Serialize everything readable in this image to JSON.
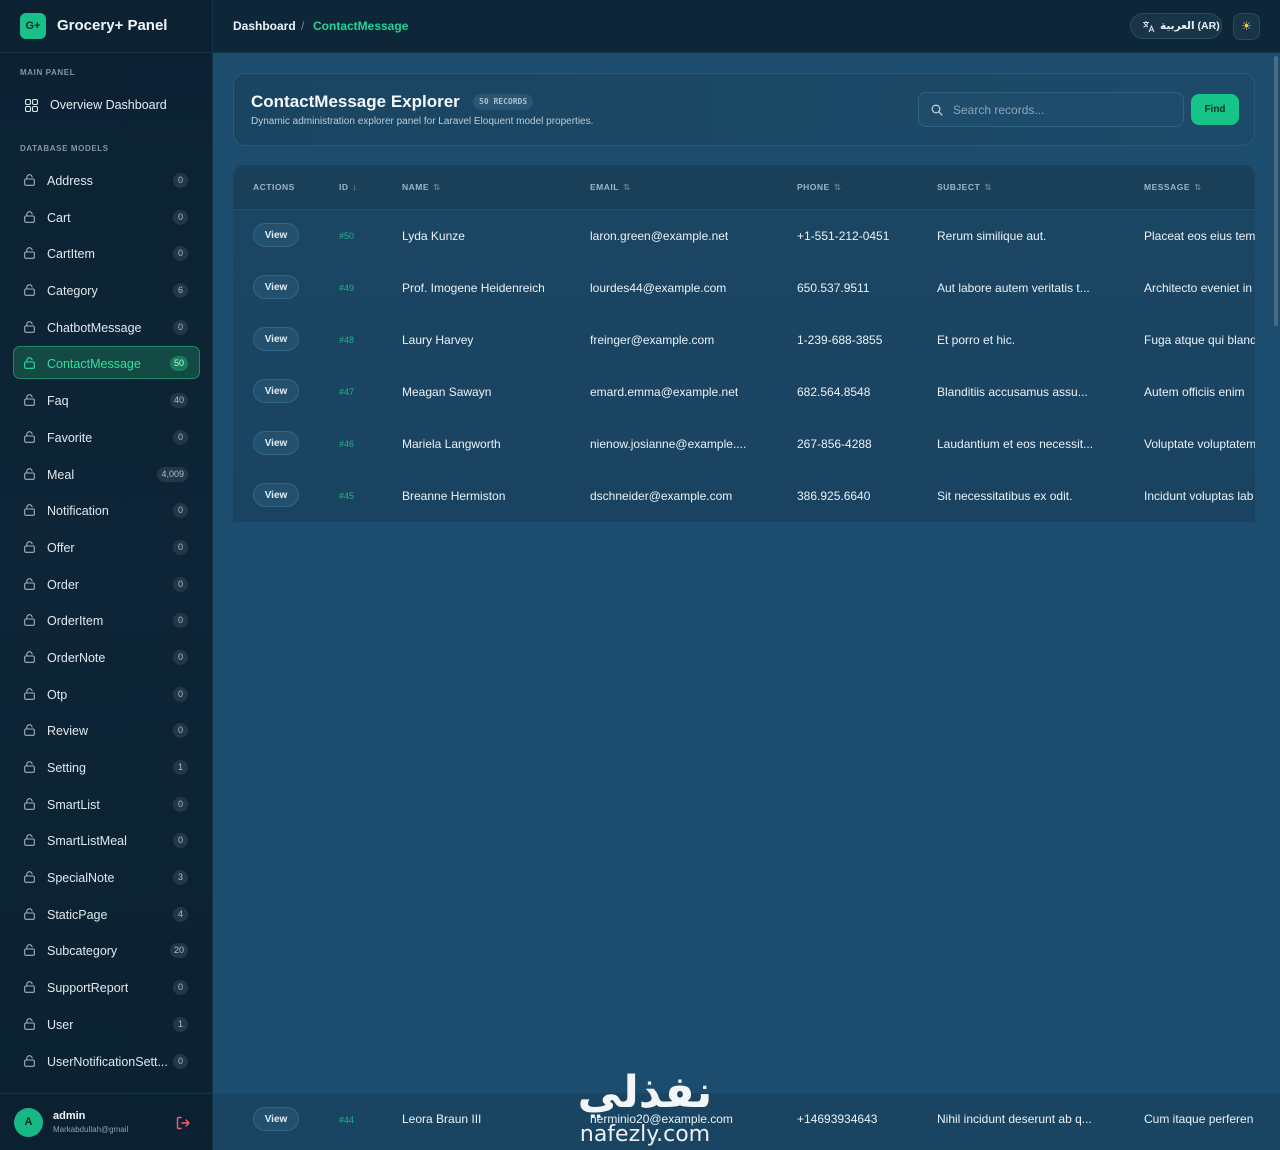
{
  "brand": {
    "logo": "G+",
    "title": "Grocery+ Panel"
  },
  "sidebar": {
    "main_label": "MAIN PANEL",
    "overview_label": "Overview Dashboard",
    "models_label": "DATABASE MODELS",
    "items": [
      {
        "label": "Address",
        "count": "0"
      },
      {
        "label": "Cart",
        "count": "0"
      },
      {
        "label": "CartItem",
        "count": "0"
      },
      {
        "label": "Category",
        "count": "6"
      },
      {
        "label": "ChatbotMessage",
        "count": "0"
      },
      {
        "label": "ContactMessage",
        "count": "50",
        "active": true
      },
      {
        "label": "Faq",
        "count": "40"
      },
      {
        "label": "Favorite",
        "count": "0"
      },
      {
        "label": "Meal",
        "count": "4,009"
      },
      {
        "label": "Notification",
        "count": "0"
      },
      {
        "label": "Offer",
        "count": "0"
      },
      {
        "label": "Order",
        "count": "0"
      },
      {
        "label": "OrderItem",
        "count": "0"
      },
      {
        "label": "OrderNote",
        "count": "0"
      },
      {
        "label": "Otp",
        "count": "0"
      },
      {
        "label": "Review",
        "count": "0"
      },
      {
        "label": "Setting",
        "count": "1"
      },
      {
        "label": "SmartList",
        "count": "0"
      },
      {
        "label": "SmartListMeal",
        "count": "0"
      },
      {
        "label": "SpecialNote",
        "count": "3"
      },
      {
        "label": "StaticPage",
        "count": "4"
      },
      {
        "label": "Subcategory",
        "count": "20"
      },
      {
        "label": "SupportReport",
        "count": "0"
      },
      {
        "label": "User",
        "count": "1"
      },
      {
        "label": "UserNotificationSett...",
        "count": "0"
      }
    ],
    "user": {
      "initial": "A",
      "name": "admin",
      "email": "Markabdullah@gmail"
    }
  },
  "topbar": {
    "crumb_home": "Dashboard",
    "crumb_sep": "/",
    "crumb_current": "ContactMessage",
    "lang_label": "العربية (AR)"
  },
  "header": {
    "title": "ContactMessage Explorer",
    "badge": "50 RECORDS",
    "subtitle": "Dynamic administration explorer panel for Laravel Eloquent model properties.",
    "search_placeholder": "Search records...",
    "find_label": "Find"
  },
  "table": {
    "columns": {
      "actions": "ACTIONS",
      "id": "ID",
      "name": "NAME",
      "email": "EMAIL",
      "phone": "PHONE",
      "subject": "SUBJECT",
      "message": "MESSAGE"
    },
    "view_label": "View",
    "rows": [
      {
        "id": "#50",
        "name": "Lyda Kunze",
        "email": "laron.green@example.net",
        "phone": "+1-551-212-0451",
        "subject": "Rerum similique aut.",
        "message": "Placeat eos eius tem"
      },
      {
        "id": "#49",
        "name": "Prof. Imogene Heidenreich",
        "email": "lourdes44@example.com",
        "phone": "650.537.9511",
        "subject": "Aut labore autem veritatis t...",
        "message": "Architecto eveniet in"
      },
      {
        "id": "#48",
        "name": "Laury Harvey",
        "email": "freinger@example.com",
        "phone": "1-239-688-3855",
        "subject": "Et porro et hic.",
        "message": "Fuga atque qui bland"
      },
      {
        "id": "#47",
        "name": "Meagan Sawayn",
        "email": "emard.emma@example.net",
        "phone": "682.564.8548",
        "subject": "Blanditiis accusamus assu...",
        "message": "Autem officiis enim"
      },
      {
        "id": "#46",
        "name": "Mariela Langworth",
        "email": "nienow.josianne@example....",
        "phone": "267-856-4288",
        "subject": "Laudantium et eos necessit...",
        "message": "Voluptate voluptatem"
      },
      {
        "id": "#45",
        "name": "Breanne Hermiston",
        "email": "dschneider@example.com",
        "phone": "386.925.6640",
        "subject": "Sit necessitatibus ex odit.",
        "message": "Incidunt voluptas lab"
      }
    ],
    "bottom_row": {
      "id": "#44",
      "name": "Leora Braun III",
      "email": "herminio20@example.com",
      "phone": "+14693934643",
      "subject": "Nihil incidunt deserunt ab q...",
      "message": "Cum itaque perferen"
    }
  },
  "watermark": {
    "arabic": "نفذلي",
    "latin": "nafezly.com"
  },
  "colors": {
    "accent": "#16c48a",
    "sidebar_bg": "#0c2233",
    "main_bg": "#1d4d6e"
  }
}
